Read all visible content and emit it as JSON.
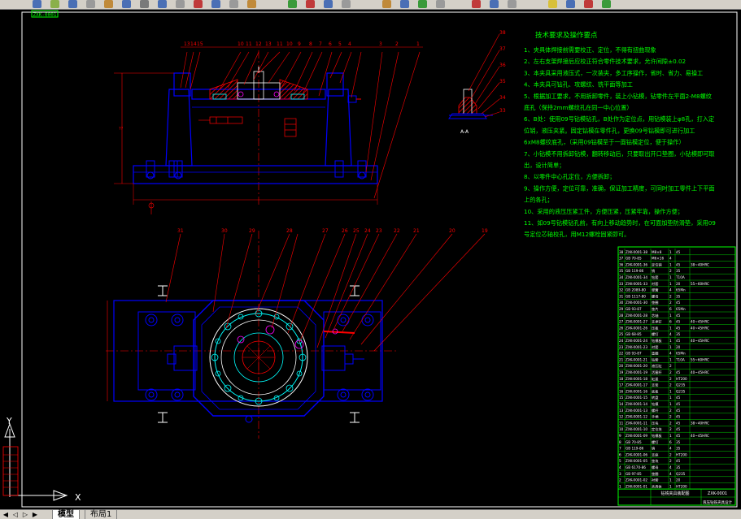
{
  "drawing": {
    "stamp": "ZXK-0001",
    "part_labels_top": [
      "13",
      "14",
      "15",
      "10",
      "11",
      "12",
      "13",
      "11",
      "10",
      "9",
      "8",
      "7",
      "6",
      "5",
      "4",
      "3",
      "2",
      "1"
    ],
    "part_labels_bottom": [
      "31",
      "30",
      "29",
      "28",
      "27",
      "26",
      "25",
      "24",
      "23",
      "22",
      "21",
      "20",
      "19"
    ],
    "section_label": "A-A",
    "section_labels_right": [
      "38",
      "37",
      "36",
      "35",
      "34",
      "33"
    ]
  },
  "tech": {
    "title": "技术要求及操作要点",
    "lines": [
      "1、夹具体焊接前需要校正、定位，不得有扭曲现象",
      "2、左右支架焊接后应校正符合零件技术要求，允许间隙±0.02",
      "3、本夹具采用液压式，一次装夹，多工序操作，省时、省力、易操工",
      "4、本夹具可钻孔、攻螺纹、铣平面等加工",
      "5、根据加工要求，不用拆卸零件，装上小钻模，钻零件左平面2-M8螺纹",
      "底孔（保持2mm螺纹孔在同一中心位置）",
      "6、B处：使用09号钻模钻孔，B处作为定位点，用钻模装上φ8孔，打入定",
      "位销，液压夹紧。固定钻模在零件孔，更换09号钻模即可进行加工",
      "6xM8螺纹底孔，（采用09钻模至于一面钻模定位，便于操作）",
      "7、小钻模不用拆卸钻模，翻转移动后，只要取出开口垫圈，小钻模即可取",
      "出，设计简单；",
      "8、以零件中心孔定位，方便拆卸；",
      "9、操作方便，定位可靠，准确，保证加工精度，可同时加工零件上下平面",
      "上的各孔；",
      "10、采用的液压压紧工件，方便压紧，压紧牢靠，操作方便；",
      "11、如09号钻模钻孔前，有向上移动趋势时，在可面加垫防滑垫，采用09",
      "号定位芯轴校孔，用M12螺栓固紧即可。"
    ]
  },
  "bom": {
    "rows": [
      [
        "38",
        "ZXK-0001-38",
        "M8×8",
        "1",
        "45",
        ""
      ],
      [
        "37",
        "GB 70-85",
        "M6×16",
        "4",
        "",
        ""
      ],
      [
        "36",
        "ZXK-0001-36",
        "定位销",
        "1",
        "45",
        "38~40HRC"
      ],
      [
        "35",
        "GB 119-86",
        "销",
        "2",
        "35",
        ""
      ],
      [
        "34",
        "ZXK-0001-34",
        "钻套",
        "1",
        "T10A",
        ""
      ],
      [
        "33",
        "ZXK-0001-33",
        "衬套",
        "1",
        "20",
        "55~60HRC"
      ],
      [
        "32",
        "GB 2089-80",
        "弹簧",
        "4",
        "65Mn",
        ""
      ],
      [
        "31",
        "GB 1117-80",
        "螺母",
        "2",
        "35",
        ""
      ],
      [
        "30",
        "ZXK-0001-30",
        "垫圈",
        "2",
        "45",
        ""
      ],
      [
        "29",
        "GB 93-87",
        "垫片",
        "6",
        "65Mn",
        ""
      ],
      [
        "28",
        "ZXK-0001-28",
        "芯轴",
        "1",
        "45",
        ""
      ],
      [
        "27",
        "ZXK-0001-27",
        "支承钉",
        "6",
        "45",
        "40~45HRC"
      ],
      [
        "26",
        "ZXK-0001-26",
        "压板",
        "1",
        "45",
        "40~45HRC"
      ],
      [
        "25",
        "GB 68-85",
        "螺钉",
        "4",
        "35",
        ""
      ],
      [
        "24",
        "ZXK-0001-24",
        "钻模板",
        "1",
        "45",
        "40~45HRC"
      ],
      [
        "23",
        "ZXK-0001-23",
        "衬套",
        "1",
        "20",
        ""
      ],
      [
        "22",
        "GB 93-87",
        "垫圈",
        "4",
        "65Mn",
        ""
      ],
      [
        "21",
        "ZXK-0001-21",
        "钻套",
        "1",
        "T10A",
        "55~60HRC"
      ],
      [
        "20",
        "ZXK-0001-20",
        "液压缸",
        "2",
        "",
        ""
      ],
      [
        "19",
        "ZXK-0001-19",
        "活塞杆",
        "2",
        "45",
        "40~45HRC"
      ],
      [
        "18",
        "ZXK-0001-18",
        "缸盖",
        "2",
        "HT200",
        ""
      ],
      [
        "17",
        "ZXK-0001-17",
        "支架",
        "2",
        "Q235",
        ""
      ],
      [
        "16",
        "ZXK-0001-16",
        "底板",
        "1",
        "Q235",
        ""
      ],
      [
        "15",
        "ZXK-0001-15",
        "转盘",
        "1",
        "45",
        ""
      ],
      [
        "14",
        "ZXK-0001-14",
        "钻模",
        "1",
        "45",
        ""
      ],
      [
        "13",
        "ZXK-0001-13",
        "螺杆",
        "2",
        "45",
        ""
      ],
      [
        "12",
        "ZXK-0001-12",
        "手柄",
        "2",
        "45",
        ""
      ],
      [
        "11",
        "ZXK-0001-11",
        "压块",
        "2",
        "45",
        "38~40HRC"
      ],
      [
        "10",
        "ZXK-0001-10",
        "定位块",
        "2",
        "45",
        ""
      ],
      [
        "9",
        "ZXK-0001-09",
        "钻模板",
        "1",
        "45",
        "40~45HRC"
      ],
      [
        "8",
        "GB 70-85",
        "螺钉",
        "6",
        "35",
        ""
      ],
      [
        "7",
        "GB 119-86",
        "销",
        "4",
        "35",
        ""
      ],
      [
        "6",
        "ZXK-0001-06",
        "支座",
        "2",
        "HT200",
        ""
      ],
      [
        "5",
        "ZXK-0001-05",
        "垫块",
        "2",
        "45",
        ""
      ],
      [
        "4",
        "GB 6170-86",
        "螺母",
        "4",
        "35",
        ""
      ],
      [
        "3",
        "GB 97-85",
        "垫圈",
        "4",
        "Q235",
        ""
      ],
      [
        "2",
        "ZXK-0001-02",
        "衬套",
        "1",
        "20",
        ""
      ],
      [
        "1",
        "ZXK-0001-01",
        "夹具体",
        "1",
        "HT200",
        ""
      ]
    ],
    "title_block": {
      "name": "钻铣夹具装配图",
      "code": "ZXK-0001",
      "school": "液压钻铣夹具设计"
    }
  },
  "tabs": {
    "model": "模型",
    "layout1": "布局1"
  },
  "ucs": {
    "x": "X",
    "y": "Y"
  },
  "colors": {
    "bg": "#000000",
    "outline": "#0000ff",
    "green": "#00ff00",
    "red": "#ff0000",
    "cyan": "#00ffff",
    "yellow": "#ffff00",
    "magenta": "#ff00ff",
    "white": "#ffffff"
  }
}
